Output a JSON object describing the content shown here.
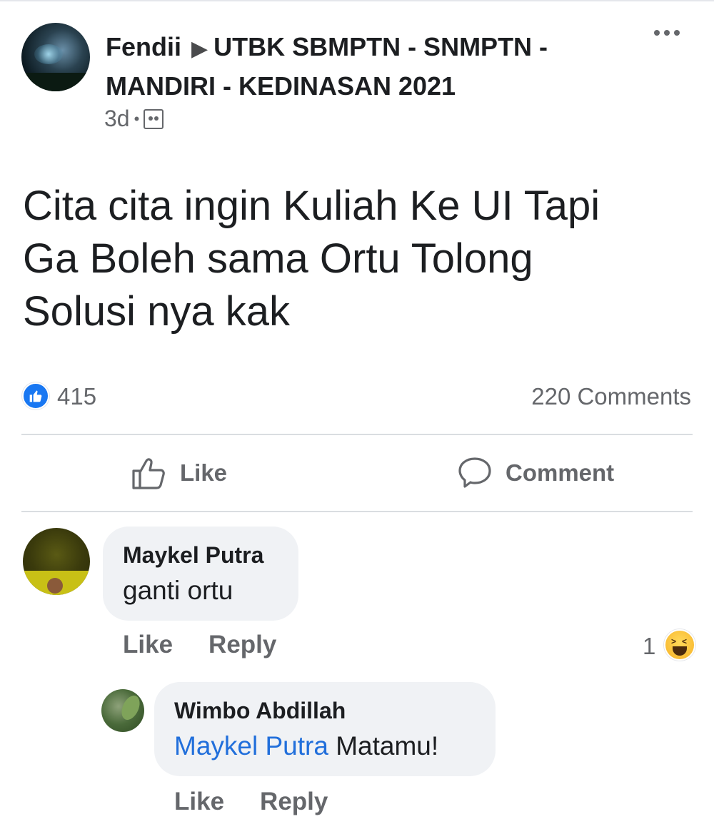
{
  "post": {
    "author": "Fendii",
    "group": "UTBK SBMPTN - SNMPTN - MANDIRI - KEDINASAN 2021",
    "time": "3d",
    "body_lines": [
      "Cita cita ingin Kuliah Ke UI Tapi",
      "Ga Boleh sama Ortu Tolong",
      "Solusi nya kak"
    ],
    "reaction_count": "415",
    "comments_count": "220 Comments",
    "like_label": "Like",
    "comment_label": "Comment"
  },
  "comments": [
    {
      "author": "Maykel Putra",
      "text": "ganti ortu",
      "like_label": "Like",
      "reply_label": "Reply",
      "reaction_count": "1",
      "reaction_icon": "haha-emoji-icon"
    },
    {
      "author": "Wimbo Abdillah",
      "mention": "Maykel Putra",
      "text": "Matamu!",
      "like_label": "Like",
      "reply_label": "Reply"
    }
  ],
  "colors": {
    "accent": "#1877f2",
    "mention": "#216fdb",
    "secondary_text": "#65676b",
    "bubble": "#f0f2f5"
  }
}
